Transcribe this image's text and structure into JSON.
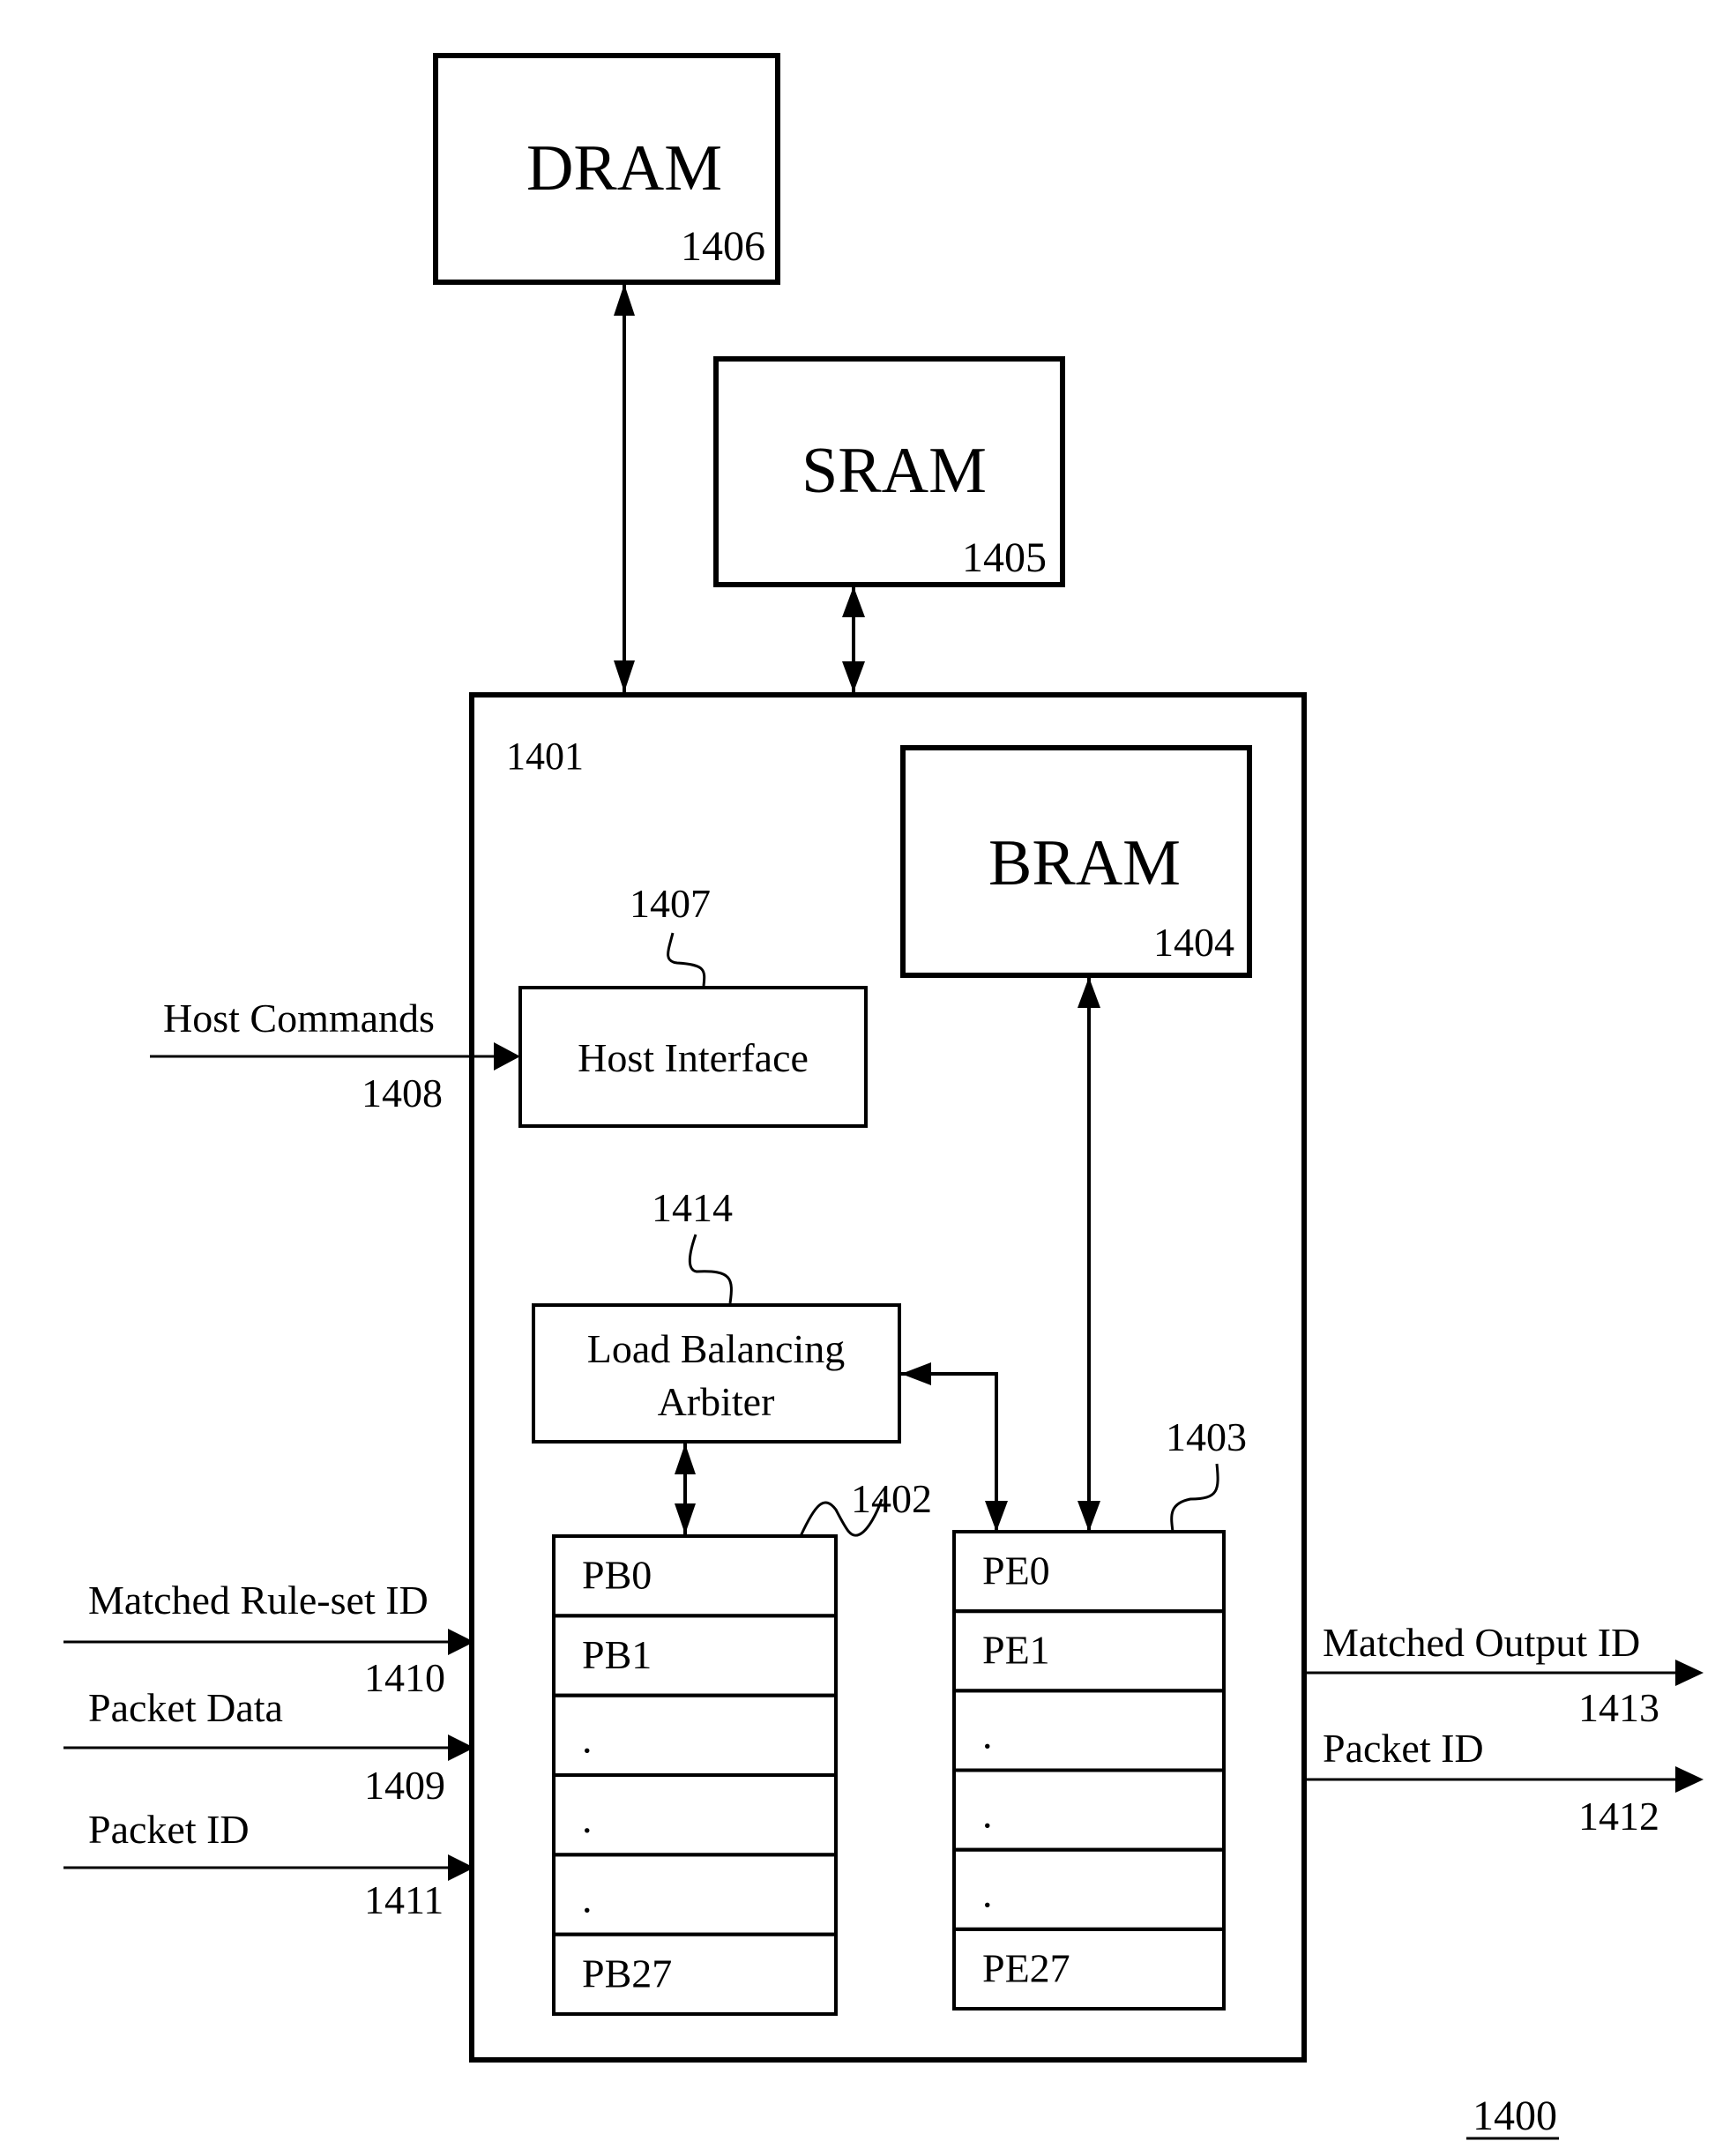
{
  "figure": {
    "number": "1400",
    "system_ref": "1401"
  },
  "memory": {
    "dram": {
      "label": "DRAM",
      "ref": "1406"
    },
    "sram": {
      "label": "SRAM",
      "ref": "1405"
    },
    "bram": {
      "label": "BRAM",
      "ref": "1404"
    }
  },
  "host_interface": {
    "label": "Host Interface",
    "ref": "1407"
  },
  "arbiter": {
    "label_line1": "Load Balancing",
    "label_line2": "Arbiter",
    "ref": "1414"
  },
  "packet_buffers": {
    "ref": "1402",
    "rows": [
      "PB0",
      "PB1",
      ".",
      ".",
      ".",
      "PB27"
    ]
  },
  "processing_engines": {
    "ref": "1403",
    "rows": [
      "PE0",
      "PE1",
      ".",
      ".",
      ".",
      "PE27"
    ]
  },
  "inputs": {
    "host_commands": {
      "label": "Host Commands",
      "ref": "1408"
    },
    "matched_ruleset_id": {
      "label": "Matched Rule-set ID",
      "ref": "1410"
    },
    "packet_data": {
      "label": "Packet Data",
      "ref": "1409"
    },
    "packet_id": {
      "label": "Packet ID",
      "ref": "1411"
    }
  },
  "outputs": {
    "matched_output_id": {
      "label": "Matched Output ID",
      "ref": "1413"
    },
    "packet_id": {
      "label": "Packet ID",
      "ref": "1412"
    }
  }
}
